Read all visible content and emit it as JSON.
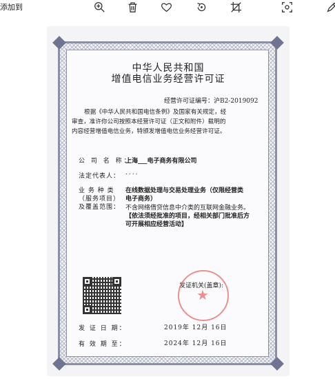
{
  "toolbar": {
    "add_to_label": "添加到",
    "icons": [
      "zoom-in-icon",
      "trash-icon",
      "heart-icon",
      "rotate-icon",
      "crop-icon",
      "focus-icon",
      "edit-icon"
    ]
  },
  "certificate": {
    "title_line1": "中华人民共和国",
    "title_line2": "增值电信业务经营许可证",
    "permit_no_label": "经营许可证编号：",
    "permit_no": "沪B2-2019092",
    "body_line1": "根据《中华人民共和国电信条例》及国家有关规定，经",
    "body_line2": "审查，准许你公司按照本经营许可证（正文和附件）载明的",
    "body_line3": "内容经营增值电信业务，特颁发增值电信业务经营许可证。",
    "company_label": "公 司 名 称：",
    "company_value": "上海___电子商务有限公司",
    "legal_rep_label": "法定代表人：",
    "legal_rep_value": "....",
    "business_label_1": "业 务 种 类",
    "business_label_2": "（服务项目）",
    "business_label_3": "及覆盖范围：",
    "business_value_1": "在线数据处理与交易处理业务（仅限经营类",
    "business_value_2": "电子商务）",
    "business_value_3": "不含网络借贷信息中介类的互联网金融业务。",
    "business_value_4": "【依法须经批准的项目，经相关部门批准后方",
    "business_value_5": "可开展相应经营活动】",
    "issuer_label": "发证机关(盖章):",
    "issue_date_label": "发 证 日 期：",
    "issue_date_value": "2019年 12月 16日",
    "expiry_label": "有 效 期 至：",
    "expiry_value": "2024年 12月 16日"
  },
  "colors": {
    "border": "#8a8fa6",
    "seal": "#e46b6b",
    "text": "#222222"
  }
}
